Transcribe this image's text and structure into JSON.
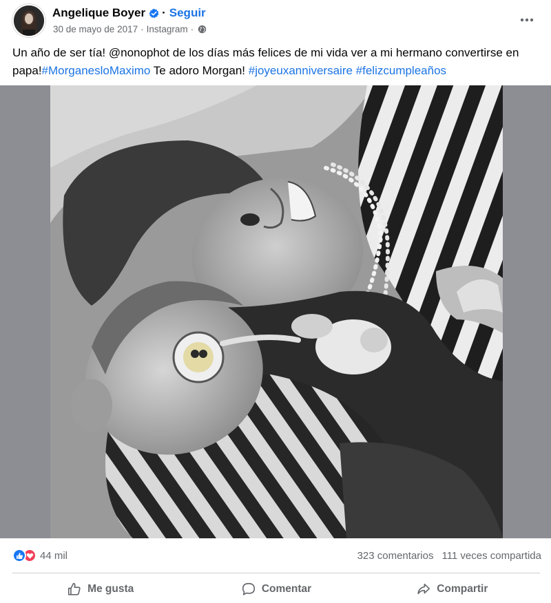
{
  "post": {
    "author": "Angelique Boyer",
    "verified": true,
    "follow_label": "Seguir",
    "date": "30 de mayo de 2017",
    "source": "Instagram",
    "audience_icon": "globe-icon",
    "caption_parts": {
      "p1": "Un año de ser tía! @nonophot de los días más felices de mi vida ver a mi hermano convertirse en papa!",
      "tag1": "#MorganesloMaximo",
      "p2": " Te adoro Morgan! ",
      "tag2": "#joyeuxanniversaire",
      "p3": " ",
      "tag3": "#felizcumpleaños"
    }
  },
  "stats": {
    "reaction_icons": [
      "like-reaction-icon",
      "love-reaction-icon"
    ],
    "reactions": "44 mil",
    "comments": "323 comentarios",
    "shares": "111 veces compartida"
  },
  "actions": {
    "like": "Me gusta",
    "comment": "Comentar",
    "share": "Compartir"
  },
  "colors": {
    "link": "#1b74e4",
    "secondary_text": "#65676b",
    "like_blue": "#1877f2",
    "love_red": "#f33e58",
    "media_background": "#8d8e94"
  }
}
